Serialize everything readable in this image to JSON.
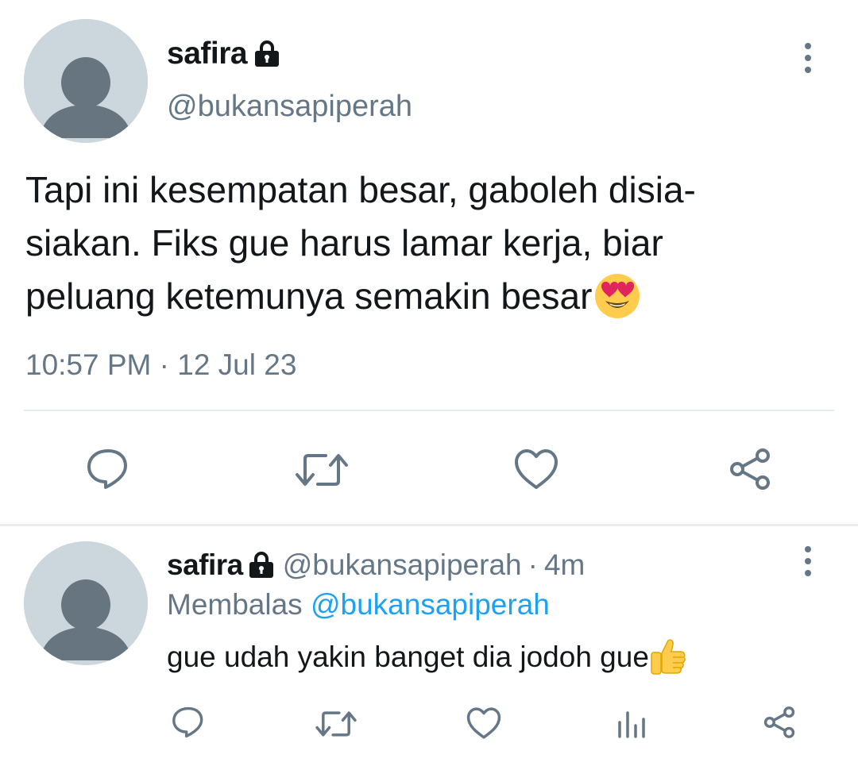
{
  "tweet": {
    "author_name": "safira",
    "handle": "@bukansapiperah",
    "text": "Tapi ini kesempatan besar, gaboleh disia-siakan. Fiks gue harus lamar kerja, biar peluang ketemunya semakin besar",
    "text_line_1": "Tapi ini kesempatan besar, gaboleh disia-",
    "text_line_2": "siakan. Fiks gue harus lamar kerja, biar",
    "text_line_3": "peluang ketemunya semakin besar",
    "emoji": "smiling-face-with-heart-eyes",
    "timestamp": "10:57 PM · 12 Jul 23",
    "locked": true,
    "actions": [
      "reply-icon",
      "retweet-icon",
      "like-icon",
      "share-icon"
    ]
  },
  "reply": {
    "author_name": "safira",
    "handle": "@bukansapiperah",
    "separator": "·",
    "time": "4m",
    "replying_to_label": "Membalas",
    "replying_to_handle": "@bukansapiperah",
    "text": "gue udah yakin banget dia jodoh gue",
    "emoji": "thumbs-up",
    "locked": true,
    "actions": [
      "reply-icon",
      "retweet-icon",
      "like-icon",
      "analytics-icon",
      "share-icon"
    ]
  },
  "colors": {
    "text_primary": "#14171a",
    "text_secondary": "#657786",
    "link": "#1da1f2",
    "divider": "#e6ecf0",
    "avatar_bg": "#ccd6dd",
    "avatar_fg": "#66757f"
  }
}
